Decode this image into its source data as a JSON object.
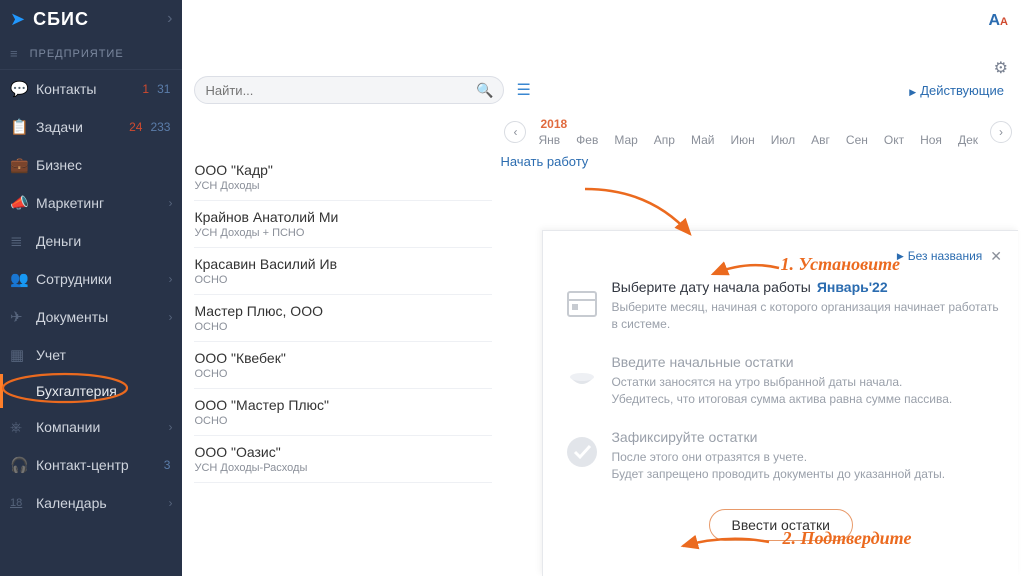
{
  "brand": "СБИС",
  "company_label": "ПРЕДПРИЯТИЕ",
  "sidebar": {
    "items": [
      {
        "label": "Контакты",
        "badge1": "1",
        "badge2": "31",
        "arrow": false
      },
      {
        "label": "Задачи",
        "badge1": "24",
        "badge2": "233",
        "arrow": false
      },
      {
        "label": "Бизнес",
        "badge1": "",
        "badge2": "",
        "arrow": false
      },
      {
        "label": "Маркетинг",
        "badge1": "",
        "badge2": "",
        "arrow": true
      },
      {
        "label": "Деньги",
        "badge1": "",
        "badge2": "",
        "arrow": false
      },
      {
        "label": "Сотрудники",
        "badge1": "",
        "badge2": "",
        "arrow": true
      },
      {
        "label": "Документы",
        "badge1": "",
        "badge2": "",
        "arrow": true
      },
      {
        "label": "Учет",
        "badge1": "",
        "badge2": "",
        "arrow": false
      },
      {
        "label": "Компании",
        "badge1": "",
        "badge2": "",
        "arrow": true
      },
      {
        "label": "Контакт-центр",
        "badge1": "",
        "badge2": "3",
        "arrow": false
      },
      {
        "label": "Календарь",
        "badge1": "",
        "badge2": "",
        "arrow": true
      }
    ],
    "subitem": "Бухгалтерия",
    "calendar_badge": "18"
  },
  "search": {
    "placeholder": "Найти..."
  },
  "filter_label": "Действующие",
  "timeline": {
    "year": "2018",
    "months": [
      "Янв",
      "Фев",
      "Мар",
      "Апр",
      "Май",
      "Июн",
      "Июл",
      "Авг",
      "Сен",
      "Окт",
      "Ноя",
      "Дек"
    ]
  },
  "begin_work": "Начать работу",
  "orgs": [
    {
      "name": "ООО \"Кадр\"",
      "sub": "УСН Доходы"
    },
    {
      "name": "Крайнов Анатолий Ми",
      "sub": "УСН Доходы + ПСНО"
    },
    {
      "name": "Красавин Василий Ив",
      "sub": "ОСНО"
    },
    {
      "name": "Мастер Плюс, ООО",
      "sub": "ОСНО"
    },
    {
      "name": "ООО \"Квебек\"",
      "sub": "ОСНО"
    },
    {
      "name": "ООО \"Мастер Плюс\"",
      "sub": "ОСНО"
    },
    {
      "name": "ООО \"Оазис\"",
      "sub": "УСН Доходы-Расходы"
    }
  ],
  "panel": {
    "title": "Без названия",
    "step1_title": "Выберите дату начала работы",
    "step1_month": "Январь'22",
    "step1_desc": "Выберите месяц, начиная с которого организация начинает работать в системе.",
    "step2_title": "Введите начальные остатки",
    "step2_desc1": "Остатки заносятся на утро выбранной даты начала.",
    "step2_desc2": "Убедитесь, что итоговая сумма актива равна сумме пассива.",
    "step3_title": "Зафиксируйте остатки",
    "step3_desc1": "После этого они отразятся в учете.",
    "step3_desc2": "Будет запрещено проводить документы до указанной даты.",
    "button": "Ввести остатки"
  },
  "annotations": {
    "a1": "1. Установите",
    "a2": "2. Подтвердите"
  }
}
